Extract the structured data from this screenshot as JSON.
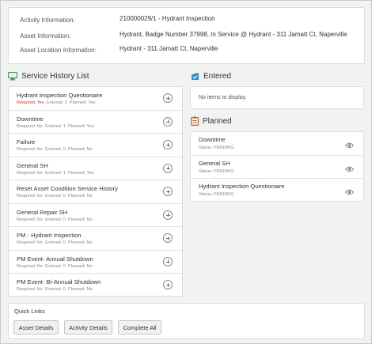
{
  "info": {
    "activity_label": "Activity Information:",
    "activity_value": "210000029/1 - Hydrant Inspection",
    "asset_label": "Asset Information:",
    "asset_value": "Hydrant, Badge Number 37998, In Service @ Hydrant - 311 Jamatt Ct, Naperville",
    "location_label": "Asset Location Information:",
    "location_value": "Hydrant - 311 Jamatt Ct, Naperville"
  },
  "service_history": {
    "title": "Service History List",
    "icon": "wrench-monitor-icon",
    "items": [
      {
        "name": "Hydrant Inspection Questionaire",
        "required": "Required: Yes",
        "entered": "Entered: 1",
        "planned": "Planned: Yes",
        "required_flag": true
      },
      {
        "name": "Downtime",
        "required": "Required: No",
        "entered": "Entered: 1",
        "planned": "Planned: Yes",
        "required_flag": false
      },
      {
        "name": "Failure",
        "required": "Required: No",
        "entered": "Entered: 0",
        "planned": "Planned: No",
        "required_flag": false
      },
      {
        "name": "General SH",
        "required": "Required: No",
        "entered": "Entered: 1",
        "planned": "Planned: Yes",
        "required_flag": false
      },
      {
        "name": "Reset Asset Condition Service History",
        "required": "Required: No",
        "entered": "Entered: 0",
        "planned": "Planned: No",
        "required_flag": false
      },
      {
        "name": "General Repair SH",
        "required": "Required: No",
        "entered": "Entered: 0",
        "planned": "Planned: No",
        "required_flag": false
      },
      {
        "name": "PM - Hydrant Inspection",
        "required": "Required: No",
        "entered": "Entered: 0",
        "planned": "Planned: No",
        "required_flag": false
      },
      {
        "name": "PM Event- Annual Shutdown",
        "required": "Required: No",
        "entered": "Entered: 0",
        "planned": "Planned: No",
        "required_flag": false
      },
      {
        "name": "PM Event- Bi-Annual Shutdown",
        "required": "Required: No",
        "entered": "Entered: 0",
        "planned": "Planned: No",
        "required_flag": false
      }
    ]
  },
  "entered": {
    "title": "Entered",
    "icon": "document-check-icon",
    "empty_text": "No items to display."
  },
  "planned": {
    "title": "Planned",
    "icon": "clipboard-icon",
    "items": [
      {
        "name": "Downtime",
        "status": "Status: PENDING"
      },
      {
        "name": "General SH",
        "status": "Status: PENDING"
      },
      {
        "name": "Hydrant Inspection Questionaire",
        "status": "Status: PENDING"
      }
    ]
  },
  "quick_links": {
    "title": "Quick Links",
    "buttons": [
      "Asset Details",
      "Activity Details",
      "Complete All"
    ]
  },
  "colors": {
    "required_yes": "#c0392b",
    "accent_icon": "#2e8bc0",
    "clipboard": "#c0652a",
    "monitor_icon": "#3a9a5a"
  }
}
